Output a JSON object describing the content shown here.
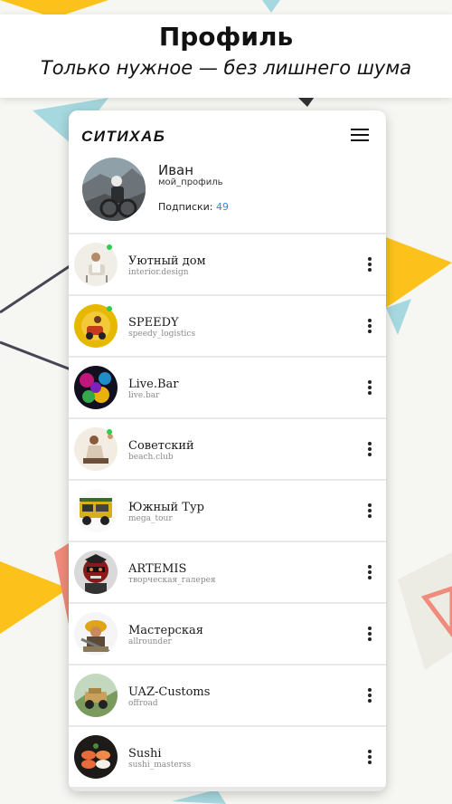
{
  "banner": {
    "title": "Профиль",
    "subtitle": "Только нужное — без лишнего шума"
  },
  "app": {
    "logo_text": "СИТИХАБ",
    "menu_icon": "hamburger-menu-icon"
  },
  "profile": {
    "name": "Иван",
    "handle": "мой_профиль",
    "subscriptions_label": "Подписки:",
    "subscriptions_count": "49"
  },
  "subscriptions": [
    {
      "name": "Уютный дом",
      "handle": "interior.design",
      "online": true
    },
    {
      "name": "SPEEDY",
      "handle": "speedy_logistics",
      "online": true
    },
    {
      "name": "Live.Bar",
      "handle": "live.bar",
      "online": false
    },
    {
      "name": "Советский",
      "handle": "beach.club",
      "online": true
    },
    {
      "name": "Южный Тур",
      "handle": "mega_tour",
      "online": false
    },
    {
      "name": "ARTEMIS",
      "handle": "творческая_галерея",
      "online": false
    },
    {
      "name": "Мастерская",
      "handle": "allrounder",
      "online": false
    },
    {
      "name": "UAZ-Customs",
      "handle": "offroad",
      "online": false
    },
    {
      "name": "Sushi",
      "handle": "sushi_masterss",
      "online": false
    }
  ],
  "colors": {
    "accent_blue": "#2c8fd6",
    "online_green": "#2ad04a",
    "deco_yellow": "#fcc21b",
    "deco_teal": "#a6d8df",
    "deco_coral": "#f08a7a"
  }
}
